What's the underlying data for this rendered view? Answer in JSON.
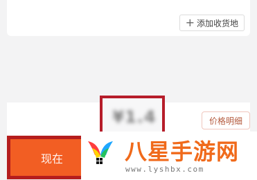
{
  "top_card": {
    "add_address_label": "添加收货地",
    "add_icon": "plus-icon"
  },
  "price_card": {
    "price_value": "¥1.4",
    "price_detail_label": "价格明细"
  },
  "buy_button": {
    "label": "现在"
  },
  "brand_overlay": {
    "name": "八星手游网",
    "url": "www.lyshbx.com",
    "logo_icon": "colorful-wing-logo-icon"
  },
  "colors": {
    "page_bg": "#f3f3f4",
    "highlight_border": "#b61d2a",
    "buy_button": "#f25e23",
    "brand_orange": "#f06a1b"
  }
}
